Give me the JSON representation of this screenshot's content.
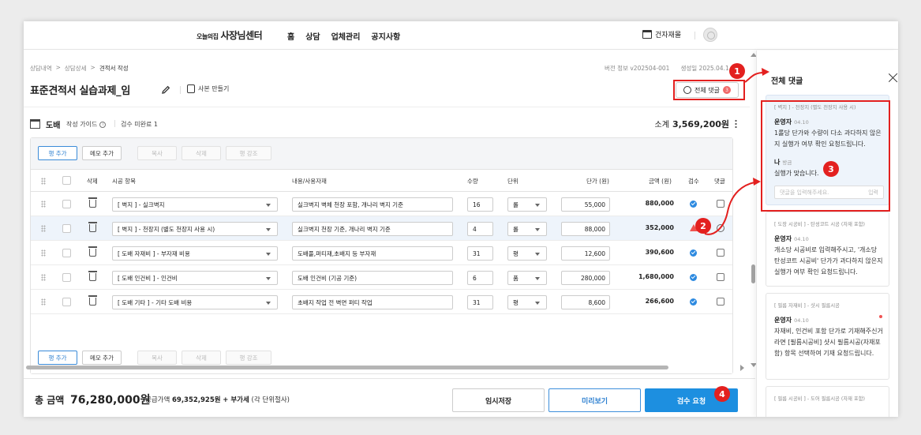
{
  "nav": {
    "brand_sub": "오늘의집",
    "brand_main": "사장님센터",
    "menu": [
      "홈",
      "상담",
      "업체관리",
      "공지사항"
    ],
    "store_label": "건자재몰"
  },
  "breadcrumb": [
    "상담내역",
    "상담상세",
    "견적서 작성"
  ],
  "meta": {
    "version": "버전 정보 v202504-001",
    "created": "생성일 2025.04.1"
  },
  "doc": {
    "title": "표준견적서 실습과제_임",
    "copy_label": "사본 만들기",
    "comment_label": "전체 댓글",
    "comment_count": "3"
  },
  "section": {
    "title": "도배",
    "guide": "작성 가이드",
    "pending": "검수 미완료 1",
    "subtotal_label": "소계",
    "subtotal_value": "3,569,200원"
  },
  "toolbar": {
    "add_row": "행 추가",
    "add_memo": "메모 추가",
    "copy": "복사",
    "delete": "삭제",
    "highlight": "행 강조"
  },
  "table": {
    "headers": [
      "삭제",
      "시공 항목",
      "내용/사용자재",
      "수량",
      "단위",
      "단가 (원)",
      "금액 (원)",
      "검수",
      "댓글"
    ],
    "rows": [
      {
        "item": "[ 벽지 ] - 실크벽지",
        "content": "실크벽지 벽체 천장 포함, 개나리 벽지 기준",
        "qty": "16",
        "unit": "롤",
        "price": "55,000",
        "amount": "880,000"
      },
      {
        "item": "[ 벽지 ] - 천장지 (별도 천장지 사용 시)",
        "content": "실크벽지 천장 기준, 개나리 벽지 기준",
        "qty": "4",
        "unit": "롤",
        "price": "88,000",
        "amount": "352,000"
      },
      {
        "item": "[ 도배 자재비 ] - 부자재 비용",
        "content": "도배풀,퍼티재,초배지 등 부자재",
        "qty": "31",
        "unit": "평",
        "price": "12,600",
        "amount": "390,600"
      },
      {
        "item": "[ 도배 인건비 ] - 인건비",
        "content": "도배 인건비 (기공 기준)",
        "qty": "6",
        "unit": "품",
        "price": "280,000",
        "amount": "1,680,000"
      },
      {
        "item": "[ 도배 기타 ] - 기타 도배 비용",
        "content": "초배지 작업 전 벽면 퍼티 작업",
        "qty": "31",
        "unit": "평",
        "price": "8,600",
        "amount": "266,600"
      }
    ]
  },
  "footer": {
    "total_label": "총 금액",
    "total_value": "76,280,000원",
    "supply_label": "공급가액",
    "supply_value": "69,352,925원",
    "vat": "+ 부가세",
    "vat_note": "(각 단위절사)",
    "save": "임시저장",
    "preview": "미리보기",
    "review": "검수 요청"
  },
  "panel": {
    "title": "전체 댓글",
    "comments": [
      {
        "tag": "[ 벽지 ] - 천장지 (별도 천장지 사용 시)",
        "author": "운영자",
        "date": "04.10",
        "body": "1롤당 단가와 수량이 다소 과다하지 않은지 실행가 여부 확인 요청드립니다.",
        "reply_author": "나",
        "reply_date": "방금",
        "reply_body": "실행가 맞습니다.",
        "placeholder": "댓글을 입력해주세요.",
        "send": "입력"
      },
      {
        "tag": "[ 도장 시공비 ] - 탄성코트 시공 (자재 포함)",
        "author": "운영자",
        "date": "04.10",
        "body": "개소당 시공비로 입력해주시고, '개소당 탄성코트 시공비' 단가가 과다하지 않은지 실행가 여부 확인 요청드립니다."
      },
      {
        "tag": "[ 필름 자재비 ] - 샷시 필름시공",
        "author": "운영자",
        "date": "04.10",
        "body": "자재비, 인건비 포함 단가로 기재해주신거라면 [필름시공비] 샷시 필름시공(자재포함) 항목 선택하여 기재 요청드립니다."
      },
      {
        "tag": "[ 필름 시공비 ] - 도어 필름시공 (자재 포함)"
      }
    ]
  },
  "annotations": [
    "1",
    "2",
    "3",
    "4"
  ],
  "colors": {
    "accent": "#1d8fe0",
    "annotation": "#e3201f",
    "warning": "#ef5350"
  }
}
